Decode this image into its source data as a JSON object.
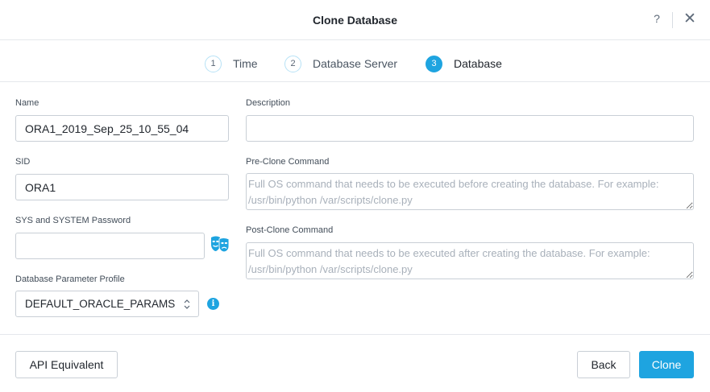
{
  "dialog": {
    "title": "Clone Database",
    "help_label": "?",
    "close_label": "✕"
  },
  "steps": [
    {
      "number": "1",
      "label": "Time",
      "active": false
    },
    {
      "number": "2",
      "label": "Database Server",
      "active": false
    },
    {
      "number": "3",
      "label": "Database",
      "active": true
    }
  ],
  "form": {
    "name": {
      "label": "Name",
      "value": "ORA1_2019_Sep_25_10_55_04"
    },
    "sid": {
      "label": "SID",
      "value": "ORA1"
    },
    "password": {
      "label": "SYS and SYSTEM Password",
      "value": ""
    },
    "param_profile": {
      "label": "Database Parameter Profile",
      "value": "DEFAULT_ORACLE_PARAMS"
    },
    "description": {
      "label": "Description",
      "value": ""
    },
    "pre_clone": {
      "label": "Pre-Clone Command",
      "placeholder": "Full OS command that needs to be executed before creating the database. For example: /usr/bin/python /var/scripts/clone.py"
    },
    "post_clone": {
      "label": "Post-Clone Command",
      "placeholder": "Full OS command that needs to be executed after creating the database. For example: /usr/bin/python /var/scripts/clone.py"
    }
  },
  "icons": {
    "mask": "mask-icon",
    "info": "info-icon",
    "accent_color": "#1ea4e0"
  },
  "footer": {
    "api_label": "API Equivalent",
    "back_label": "Back",
    "clone_label": "Clone"
  }
}
